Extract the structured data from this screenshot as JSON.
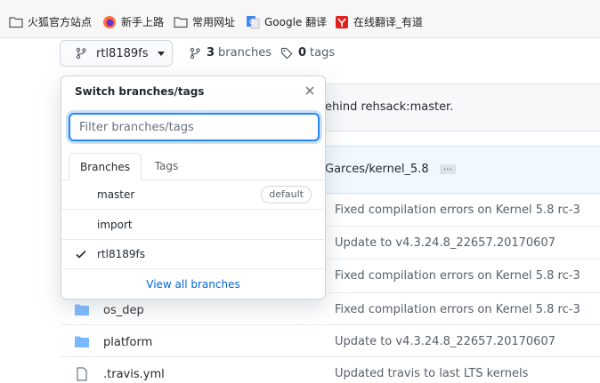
{
  "bookmarks": [
    {
      "label": "火狐官方站点",
      "icon": "folder-icon"
    },
    {
      "label": "新手上路",
      "icon": "firefox-icon"
    },
    {
      "label": "常用网址",
      "icon": "folder-icon"
    },
    {
      "label": "Google 翻译",
      "icon": "google-translate-icon"
    },
    {
      "label": "在线翻译_有道",
      "icon": "youdao-icon"
    }
  ],
  "repo_nav": {
    "branch_button_label": "rtl8189fs",
    "branches_count": "3",
    "branches_label": "branches",
    "tags_count": "0",
    "tags_label": "tags"
  },
  "background": {
    "banner_text": "ehind rehsack:master.",
    "commit_text": "Garces/kernel_5.8",
    "ellipsis": "…",
    "commit_messages": [
      "Fixed compilation errors on Kernel 5.8 rc-3",
      "Update to v4.3.24.8_22657.20170607",
      "Fixed compilation errors on Kernel 5.8 rc-3",
      "Fixed compilation errors on Kernel 5.8 rc-3",
      "Update to v4.3.24.8_22657.20170607",
      "Updated travis to last LTS kernels"
    ],
    "files": [
      {
        "name": "os_dep",
        "icon": "folder-icon"
      },
      {
        "name": "platform",
        "icon": "folder-icon"
      },
      {
        "name": ".travis.yml",
        "icon": "file-icon"
      }
    ]
  },
  "dropdown": {
    "title": "Switch branches/tags",
    "filter_placeholder": "Filter branches/tags",
    "filter_value": "",
    "tabs": [
      "Branches",
      "Tags"
    ],
    "active_tab": "Branches",
    "items": [
      {
        "label": "master",
        "badge": "default",
        "selected": false
      },
      {
        "label": "import",
        "badge": "",
        "selected": false
      },
      {
        "label": "rtl8189fs",
        "badge": "",
        "selected": true
      }
    ],
    "footer_link": "View all branches"
  },
  "colors": {
    "link": "#0366d6",
    "focus": "#2188ff",
    "folder": "#79b8ff"
  }
}
